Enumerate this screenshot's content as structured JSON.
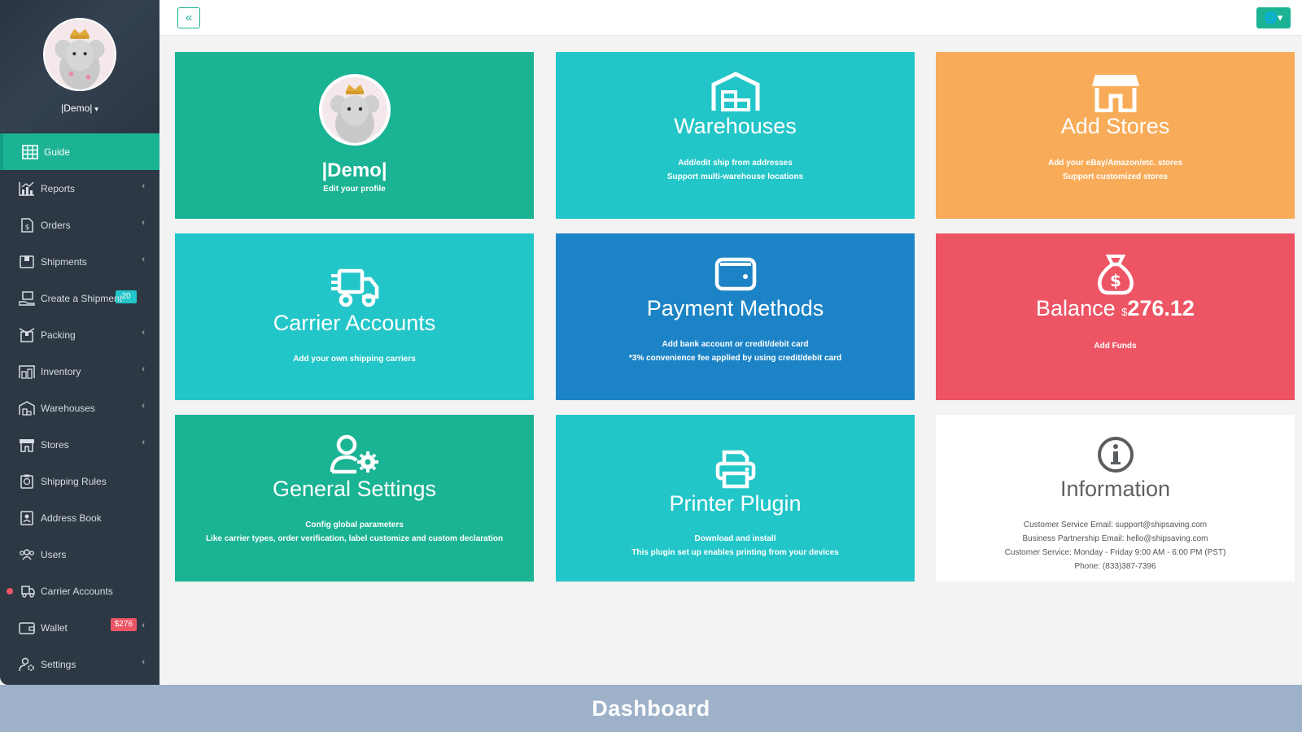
{
  "sidebar": {
    "user_name": "|Demo|",
    "items": [
      {
        "label": "Guide",
        "icon": "grid-icon"
      },
      {
        "label": "Reports",
        "icon": "chart-icon"
      },
      {
        "label": "Orders",
        "icon": "invoice-icon",
        "badge": "20"
      },
      {
        "label": "Shipments",
        "icon": "box-icon"
      },
      {
        "label": "Create a Shipment",
        "icon": "create-shipment-icon"
      },
      {
        "label": "Packing",
        "icon": "packing-icon"
      },
      {
        "label": "Inventory",
        "icon": "inventory-icon"
      },
      {
        "label": "Warehouses",
        "icon": "warehouse-icon"
      },
      {
        "label": "Stores",
        "icon": "store-icon"
      },
      {
        "label": "Shipping Rules",
        "icon": "rules-icon"
      },
      {
        "label": "Address Book",
        "icon": "address-book-icon"
      },
      {
        "label": "Users",
        "icon": "users-icon"
      },
      {
        "label": "Carrier Accounts",
        "icon": "truck-icon"
      },
      {
        "label": "Wallet",
        "icon": "wallet-icon",
        "badge": "$276"
      },
      {
        "label": "Settings",
        "icon": "user-gear-icon"
      }
    ]
  },
  "topbar": {
    "collapse_glyph": "«",
    "lang_glyph": "🌐▾"
  },
  "cards": {
    "profile": {
      "title": "|Demo|",
      "sub": "Edit your profile"
    },
    "warehouses": {
      "title": "Warehouses",
      "sub1": "Add/edit ship from addresses",
      "sub2": "Support multi-warehouse locations"
    },
    "stores": {
      "title": "Add Stores",
      "sub1": "Add your eBay/Amazon/etc. stores",
      "sub2": "Support customized stores"
    },
    "carriers": {
      "title": "Carrier Accounts",
      "sub": "Add your own shipping carriers"
    },
    "payment": {
      "title": "Payment Methods",
      "sub1": "Add bank account or credit/debit card",
      "sub2": "*3% convenience fee applied by using credit/debit card"
    },
    "balance": {
      "title": "Balance",
      "currency": "$",
      "amount": "276.12",
      "sub": "Add Funds"
    },
    "settings": {
      "title": "General Settings",
      "sub1": "Config global parameters",
      "sub2": "Like carrier types, order verification, label customize and custom declaration"
    },
    "printer": {
      "title": "Printer Plugin",
      "sub1": "Download and install",
      "sub2": "This plugin set up enables printing from your devices"
    },
    "info": {
      "title": "Information",
      "line1": "Customer Service Email: support@shipsaving.com",
      "line2": "Business Partnership Email: hello@shipsaving.com",
      "line3": "Customer Service: Monday - Friday 9:00 AM - 6:00 PM (PST)",
      "line4": "Phone: (833)387-7396"
    }
  },
  "footer": {
    "caption": "Dashboard"
  },
  "colors": {
    "sidebar": "#2d3844",
    "green": "#1ab394",
    "cyan": "#23c6c8",
    "blue": "#1c84c6",
    "orange": "#f8ac59",
    "red": "#ed5565",
    "footer": "#9db1c9"
  }
}
